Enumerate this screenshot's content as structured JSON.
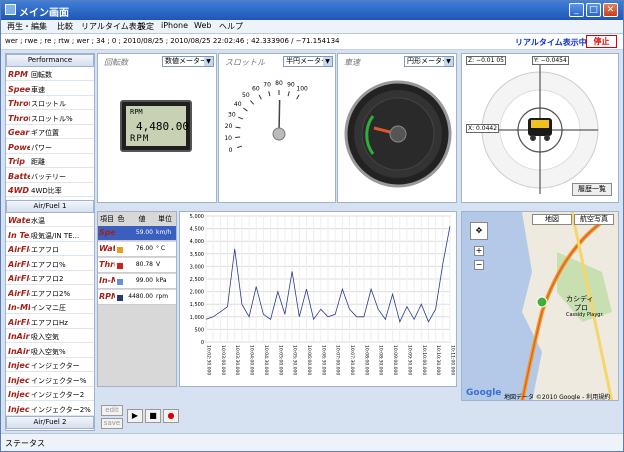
{
  "window": {
    "title": "メイン画面"
  },
  "menu": [
    "再生・編集",
    "比較",
    "リアルタイム表示",
    "設定",
    "iPhone",
    "Web",
    "ヘルプ"
  ],
  "info": {
    "text": "wer ; rwe ; re ; rtw ; wer ; 34 ; 0 ; 2010/08/25 ; 2010/08/25 22:02:46 ; 42.333906 / −71.154134",
    "realtime_label": "リアルタイム表示中",
    "stop_label": "停止"
  },
  "sidebar": {
    "groups": [
      {
        "label": "Performance",
        "items": [
          {
            "icon": "RPM",
            "label": "回転数"
          },
          {
            "icon": "Speed",
            "label": "車速"
          },
          {
            "icon": "Throttle",
            "label": "スロットル"
          },
          {
            "icon": "Throttle%",
            "label": "スロットル%"
          },
          {
            "icon": "Gear Pos",
            "label": "ギア位置"
          },
          {
            "icon": "Power",
            "label": "パワー"
          },
          {
            "icon": "Trip",
            "label": "距離"
          },
          {
            "icon": "Battery",
            "label": "バッテリー"
          },
          {
            "icon": "4WD Ratio",
            "label": "4WD比率"
          }
        ]
      },
      {
        "label": "Air/Fuel 1",
        "items": [
          {
            "icon": "Water Temp",
            "label": "水温"
          },
          {
            "icon": "In Temp",
            "label": "吸気温/IN TE..."
          },
          {
            "icon": "AirFlow",
            "label": "エアフロ"
          },
          {
            "icon": "AirFlow%",
            "label": "エアフロ%"
          },
          {
            "icon": "AirFlow2",
            "label": "エアフロ2"
          },
          {
            "icon": "AirFlow2%",
            "label": "エアフロ2%"
          },
          {
            "icon": "In-MF",
            "label": "インマニ圧"
          },
          {
            "icon": "AirFlowHz",
            "label": "エアフロHz"
          },
          {
            "icon": "InAir",
            "label": "吸入空気"
          },
          {
            "icon": "InAir%",
            "label": "吸入空気%"
          },
          {
            "icon": "Injector",
            "label": "インジェクター"
          },
          {
            "icon": "Injector%",
            "label": "インジェクター%"
          },
          {
            "icon": "Injector2",
            "label": "インジェクター2"
          },
          {
            "icon": "Injector2%",
            "label": "インジェクター2%"
          }
        ]
      },
      {
        "label": "Air/Fuel 2",
        "items": []
      }
    ]
  },
  "gauges": {
    "rpm": {
      "title": "回転数",
      "mode": "数値メーター",
      "lcd_tag": "RPM",
      "value": "4,480.00",
      "unit": "RPM"
    },
    "throttle": {
      "title": "スロットル",
      "mode": "半円メーター",
      "ticks": [
        "0",
        "10",
        "20",
        "30",
        "40",
        "50",
        "60",
        "70",
        "80",
        "90",
        "100"
      ],
      "value": 80.78
    },
    "speed": {
      "title": "車速",
      "mode": "円形メーター",
      "value": 59.0
    }
  },
  "gsensor": {
    "z_label": "Z: −0.01 05",
    "y_label": "Y: −0.0454",
    "x_label": "X: 0.0442",
    "history_label": "履歴一覧"
  },
  "table": {
    "headers": [
      "項目",
      "色",
      "値",
      "単位"
    ],
    "rows": [
      {
        "icon": "Speed",
        "color": "#3a5fbf",
        "value": "59.00",
        "unit": "km/h",
        "selected": true
      },
      {
        "icon": "Water Temp",
        "color": "#e8a020",
        "value": "76.00",
        "unit": "° C",
        "selected": false
      },
      {
        "icon": "Throttle",
        "color": "#d02020",
        "value": "80.78",
        "unit": "V",
        "selected": false
      },
      {
        "icon": "In-MF PRS",
        "color": "#6a8fd8",
        "value": "99.00",
        "unit": "kPa",
        "selected": false
      },
      {
        "icon": "RPM",
        "color": "#2a3a6a",
        "value": "4480.00",
        "unit": "rpm",
        "selected": false
      }
    ]
  },
  "chart_data": {
    "type": "line",
    "ylim": [
      0,
      5000
    ],
    "yticks": [
      "5,000",
      "4,500",
      "4,000",
      "3,500",
      "3,000",
      "2,500",
      "2,000",
      "1,500",
      "1,000",
      "500",
      "0"
    ],
    "xticks": [
      "10:02:30.000",
      "10:02:45.000",
      "10:03:00.000",
      "10:03:15.000",
      "10:03:30.000",
      "10:03:45.000",
      "10:04:00.000",
      "10:04:15.000",
      "10:04:30.000",
      "10:04:45.000",
      "10:05:00.000",
      "10:05:15.000",
      "10:05:30.000",
      "10:05:45.000",
      "10:06:00.000",
      "10:06:15.000",
      "10:06:30.000",
      "10:06:45.000",
      "10:07:00.000",
      "10:07:15.000",
      "10:07:30.000",
      "10:07:45.000",
      "10:08:00.000",
      "10:08:15.000",
      "10:08:30.000",
      "10:08:45.000",
      "10:09:00.000",
      "10:09:15.000",
      "10:09:30.000",
      "10:09:45.000",
      "10:10:00.000",
      "10:10:15.000",
      "10:10:30.000",
      "10:10:45.000",
      "10:11:00.000"
    ],
    "series": [
      {
        "color": "#2a3a8a",
        "values": [
          900,
          1000,
          1200,
          1400,
          3700,
          1500,
          1000,
          2200,
          1100,
          900,
          2000,
          1100,
          2800,
          1000,
          2100,
          900,
          1300,
          1000,
          1100,
          2100,
          1300,
          1000,
          1000,
          2100,
          1300,
          900,
          1900,
          800,
          1400,
          900,
          1500,
          800,
          1300,
          3100,
          4600
        ]
      }
    ]
  },
  "playback": {
    "edit_label": "edit",
    "save_label": "save"
  },
  "map": {
    "tab_map": "地図",
    "tab_photo": "航空写真",
    "label1": "カシディ",
    "label2": "プロ",
    "label3": "Cassidy Playgr.",
    "copyright": "地図データ ©2010 Google - 利用規約",
    "google": "Google"
  },
  "status": {
    "text": "ステータス"
  }
}
